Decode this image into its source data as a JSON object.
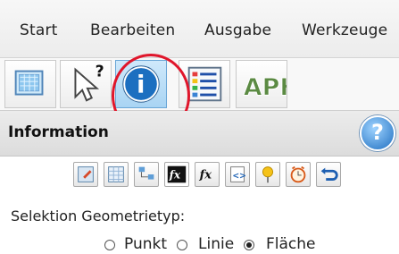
{
  "menu": {
    "items": [
      "Start",
      "Bearbeiten",
      "Ausgabe",
      "Werkzeuge"
    ]
  },
  "toolbar": {
    "tools": [
      {
        "icon": "map-layers-icon"
      },
      {
        "icon": "help-pointer-icon",
        "mark": "?"
      },
      {
        "icon": "information-icon",
        "mark": "i"
      },
      {
        "icon": "legend-list-icon"
      },
      {
        "icon": "apk-logo-icon",
        "text": "APK"
      }
    ]
  },
  "panel": {
    "title": "Information",
    "help": "?"
  },
  "small_tools": [
    {
      "icon": "edit-table-icon"
    },
    {
      "icon": "table-icon"
    },
    {
      "icon": "tree-icon"
    },
    {
      "icon": "fx-black-icon",
      "text": "fx"
    },
    {
      "icon": "fx-icon",
      "text": "fx"
    },
    {
      "icon": "code-icon",
      "text": "<>"
    },
    {
      "icon": "pin-icon"
    },
    {
      "icon": "clock-icon"
    },
    {
      "icon": "back-arrow-icon"
    }
  ],
  "selection": {
    "label": "Selektion Geometrietyp:",
    "options": [
      "Punkt",
      "Linie",
      "Fläche"
    ],
    "selected": "Fläche"
  }
}
